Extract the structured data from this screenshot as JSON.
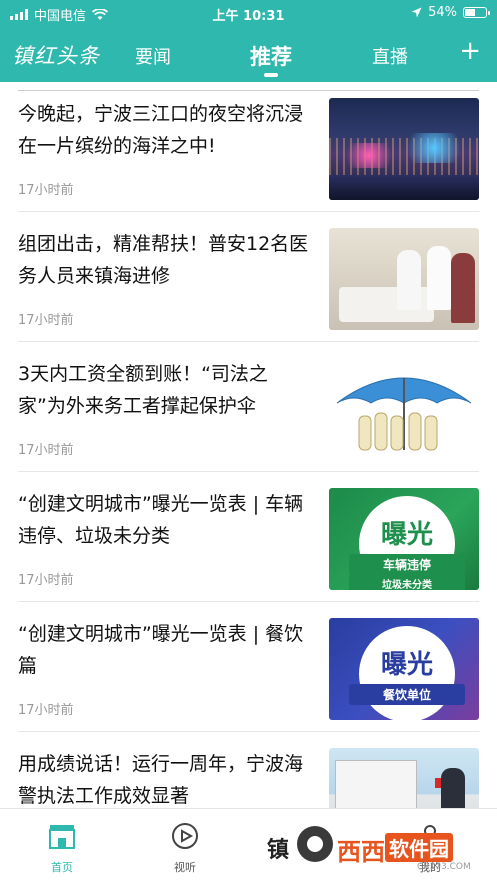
{
  "status_bar": {
    "carrier": "中国电信",
    "time": "上午 10:31",
    "battery_percent": "54%",
    "battery_level": 0.54,
    "icons": [
      "signal-icon",
      "wifi-icon",
      "location-arrow-icon",
      "battery-icon"
    ]
  },
  "top_nav": {
    "logo_text": "镇红头条",
    "tabs": [
      {
        "label": "要闻",
        "active": false
      },
      {
        "label": "推荐",
        "active": true
      },
      {
        "label": "直播",
        "active": false
      }
    ],
    "add_icon": "plus-icon"
  },
  "articles": [
    {
      "title": "今晚起，宁波三江口的夜空将沉浸在一片缤纷的海洋之中!",
      "time": "17小时前",
      "thumb": "city-night-image"
    },
    {
      "title": "组团出击，精准帮扶！普安12名医务人员来镇海进修",
      "time": "17小时前",
      "thumb": "hospital-visit-image"
    },
    {
      "title": "3天内工资全额到账！“司法之家”为外来务工者撑起保护伞",
      "time": "17小时前",
      "thumb": "umbrella-illustration-image"
    },
    {
      "title": "“创建文明城市”曝光一览表 | 车辆违停、垃圾未分类",
      "time": "17小时前",
      "thumb": "exposure-badge-image",
      "badge_big": "曝光",
      "badge_sub": "车辆违停",
      "badge_sub2": "垃圾未分类"
    },
    {
      "title": "“创建文明城市”曝光一览表 | 餐饮篇",
      "time": "17小时前",
      "thumb": "exposure-badge-image",
      "badge_big": "曝光",
      "badge_sub": "餐饮单位"
    },
    {
      "title": "用成绩说话！运行一周年，宁波海警执法工作成效显著",
      "time": "",
      "thumb": "coast-guard-image"
    }
  ],
  "bottom_tabs": [
    {
      "label": "首页",
      "icon": "home-icon",
      "active": true
    },
    {
      "label": "视听",
      "icon": "play-circle-icon",
      "active": false
    },
    {
      "label": "我的",
      "icon": "user-icon",
      "active": false
    }
  ],
  "watermark": {
    "text_a": "西西",
    "text_b": "软件园",
    "url": "CR173.COM",
    "ghost": "镇"
  },
  "colors": {
    "brand": "#2fb8ad",
    "watermark": "#e8541e"
  }
}
